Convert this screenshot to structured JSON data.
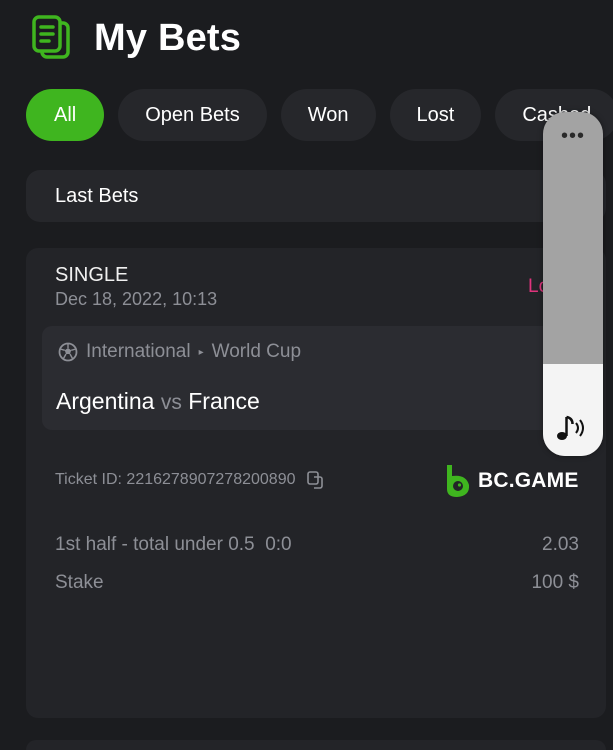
{
  "header": {
    "title": "My Bets",
    "icon": "bets-document-icon"
  },
  "tabs": [
    {
      "label": "All",
      "active": true
    },
    {
      "label": "Open Bets",
      "active": false
    },
    {
      "label": "Won",
      "active": false
    },
    {
      "label": "Lost",
      "active": false
    },
    {
      "label": "Cashed",
      "active": false
    }
  ],
  "section": {
    "label": "Last Bets"
  },
  "bet": {
    "type": "SINGLE",
    "date": "Dec 18, 2022, 10:13",
    "status": "Lost",
    "league": {
      "category": "International",
      "name": "World Cup"
    },
    "home_team": "Argentina",
    "vs": "vs",
    "away_team": "France",
    "ticket_label": "Ticket ID: 2216278907278200890",
    "selection": {
      "market": "1st half - total under 0.5",
      "score": "0:0",
      "odds": "2.03"
    },
    "stake": {
      "label": "Stake",
      "value": "100 $"
    }
  },
  "brand": {
    "name": "BC.GAME"
  },
  "overlay": {
    "menu_icon": "more-dots-icon",
    "audio_icon": "music-note-icon"
  },
  "colors": {
    "accent": "#3fb51f",
    "background": "#1b1c1f",
    "card": "#232428",
    "lost": "#e0347d"
  }
}
